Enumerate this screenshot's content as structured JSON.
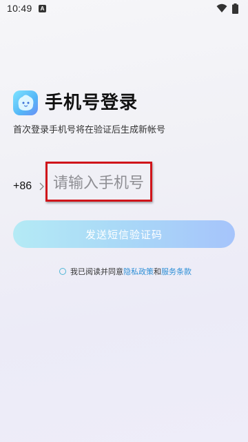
{
  "status_bar": {
    "time": "10:49",
    "notification_icon": "a-letter-icon",
    "wifi_icon": "wifi-icon",
    "battery_icon": "battery-icon"
  },
  "header": {
    "logo_icon": "app-logo-icon",
    "title": "手机号登录",
    "subtitle": "首次登录手机号将在验证后生成新帐号"
  },
  "phone_form": {
    "country_code": "+86",
    "chevron_icon": "chevron-right-icon",
    "phone_value": "",
    "phone_placeholder": "请输入手机号",
    "highlight_color": "#d0141a"
  },
  "send_button": {
    "label": "发送短信验证码",
    "enabled": false
  },
  "agreement": {
    "checked": false,
    "prefix": "我已阅读并同意",
    "privacy_link": "隐私政策",
    "conjunction": "和",
    "terms_link": "服务条款",
    "link_color": "#2e8fd6"
  }
}
